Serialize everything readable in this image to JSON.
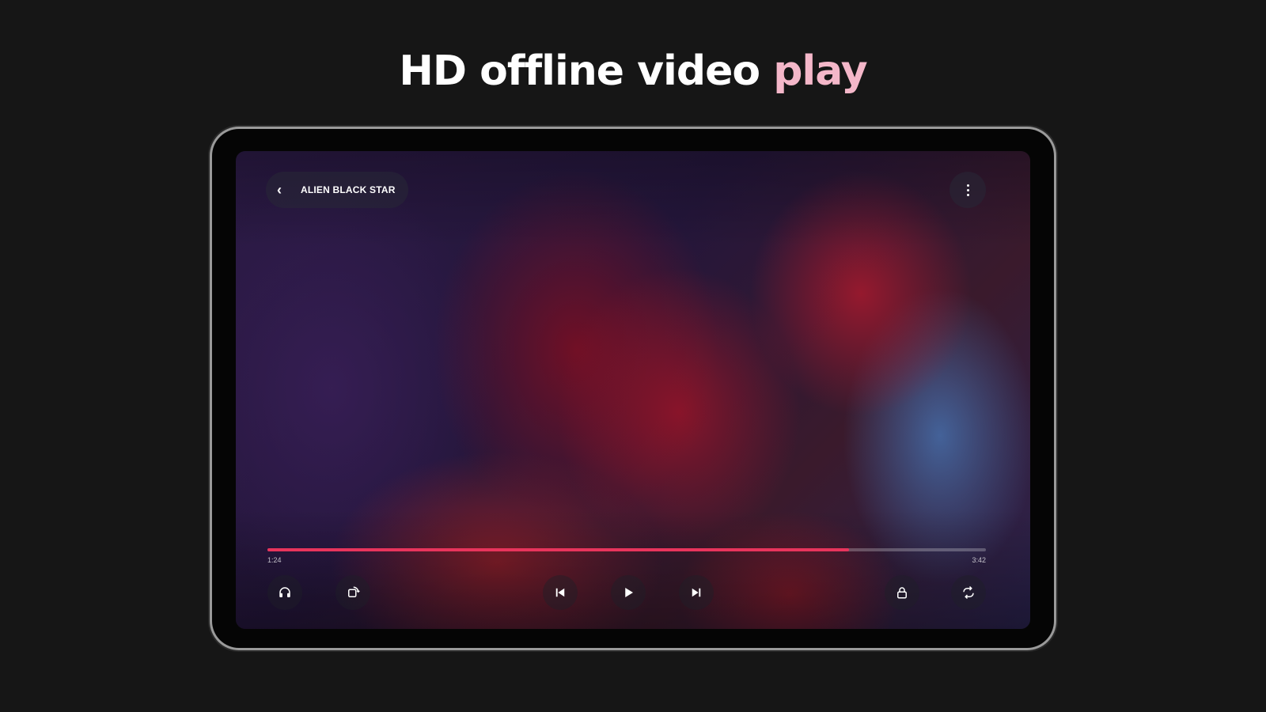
{
  "headline": {
    "main": "HD offline video",
    "accent": "play"
  },
  "player": {
    "title": "ALIEN BLACK STAR",
    "current_time": "1:24",
    "duration": "3:42",
    "progress_fraction": 0.81,
    "accent_color": "#e8345c",
    "controls": {
      "left": [
        "headphones-icon",
        "rotate-icon"
      ],
      "center": [
        "skip-previous-icon",
        "play-icon",
        "skip-next-icon"
      ],
      "right": [
        "lock-icon",
        "repeat-icon"
      ]
    }
  }
}
